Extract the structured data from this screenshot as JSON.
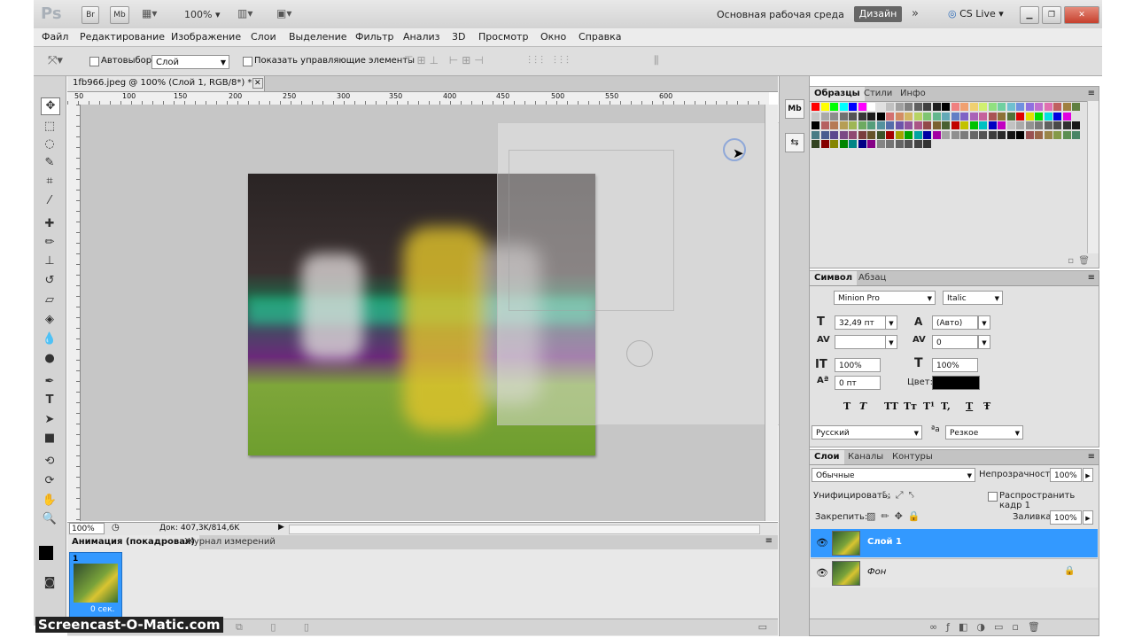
{
  "app": {
    "logo": "Ps",
    "workspace": "Основная рабочая среда",
    "design_button": "Дизайн",
    "cs_live": "CS Live",
    "zoom": "100%",
    "bridge": "Br",
    "minibridge": "Mb"
  },
  "menu": [
    "Файл",
    "Редактирование",
    "Изображение",
    "Слои",
    "Выделение",
    "Фильтр",
    "Анализ",
    "3D",
    "Просмотр",
    "Окно",
    "Справка"
  ],
  "options": {
    "autoselect_label": "Автовыбор:",
    "autoselect_value": "Слой",
    "show_controls_label": "Показать управляющие элементы"
  },
  "document": {
    "tab_title": "1fb966.jpeg @ 100% (Слой 1, RGB/8*) *",
    "zoom": "100%",
    "status": "Док: 407,3K/814,6K",
    "ruler_marks": [
      "50",
      "100",
      "150",
      "200",
      "250",
      "300",
      "350",
      "400",
      "450",
      "500",
      "550",
      "600"
    ]
  },
  "animation_panel": {
    "tabs": [
      "Анимация (покадровая)",
      "Журнал измерений"
    ],
    "frame_number": "1",
    "frame_time": "0 сек."
  },
  "swatches_panel": {
    "tabs": [
      "Образцы",
      "Стили",
      "Инфо"
    ]
  },
  "character_panel": {
    "tabs": [
      "Символ",
      "Абзац"
    ],
    "font_family": "Minion Pro",
    "font_style": "Italic",
    "size": "32,49 пт",
    "leading": "(Авто)",
    "kerning": "",
    "tracking": "0",
    "vscale": "100%",
    "hscale": "100%",
    "baseline": "0 пт",
    "color_label": "Цвет:",
    "style_buttons": [
      "T",
      "T",
      "TT",
      "Tт",
      "T¹",
      "T,",
      "T",
      "Ŧ"
    ],
    "language": "Русский",
    "aa_label": "a",
    "antialias": "Резкое"
  },
  "layers_panel": {
    "tabs": [
      "Слои",
      "Каналы",
      "Контуры"
    ],
    "blend_mode": "Обычные",
    "opacity_label": "Непрозрачность:",
    "opacity": "100%",
    "unify_label": "Унифицировать:",
    "propagate_label": "Распространить кадр 1",
    "lock_label": "Закрепить:",
    "fill_label": "Заливка:",
    "fill": "100%",
    "layers": [
      {
        "name": "Слой 1",
        "selected": true
      },
      {
        "name": "Фон",
        "selected": false,
        "locked": true
      }
    ]
  },
  "watermark": "Screencast-O-Matic.com",
  "colors": {
    "selection": "#3399ff",
    "panel": "#e2e2e2",
    "foreground": "#000000",
    "background": "#ffffff"
  }
}
